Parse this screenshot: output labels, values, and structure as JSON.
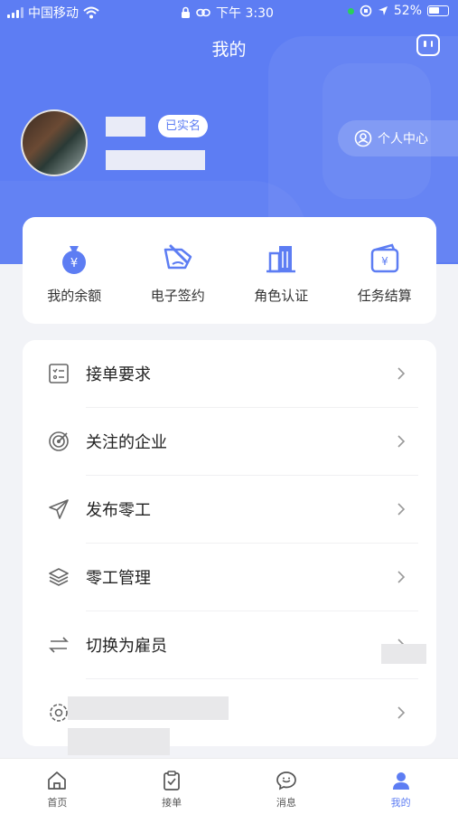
{
  "status_bar": {
    "carrier": "中国移动",
    "time": "下午 3:30",
    "battery": "52%"
  },
  "header": {
    "title": "我的"
  },
  "profile": {
    "verified_badge": "已实名",
    "personal_center": "个人中心"
  },
  "quick_actions": [
    {
      "label": "我的余额",
      "icon": "money-bag-icon"
    },
    {
      "label": "电子签约",
      "icon": "sign-icon"
    },
    {
      "label": "角色认证",
      "icon": "buildings-icon"
    },
    {
      "label": "任务结算",
      "icon": "wallet-icon"
    }
  ],
  "menu": [
    {
      "label": "接单要求",
      "icon": "checklist-icon"
    },
    {
      "label": "关注的企业",
      "icon": "target-icon"
    },
    {
      "label": "发布零工",
      "icon": "paper-plane-icon"
    },
    {
      "label": "零工管理",
      "icon": "layers-icon"
    },
    {
      "label": "切换为雇员",
      "icon": "switch-icon"
    }
  ],
  "tabbar": [
    {
      "label": "首页",
      "icon": "home-icon"
    },
    {
      "label": "接单",
      "icon": "clipboard-check-icon"
    },
    {
      "label": "消息",
      "icon": "message-icon"
    },
    {
      "label": "我的",
      "icon": "user-icon",
      "active": true
    }
  ],
  "colors": {
    "primary": "#5d7df3",
    "background": "#f2f3f7"
  }
}
